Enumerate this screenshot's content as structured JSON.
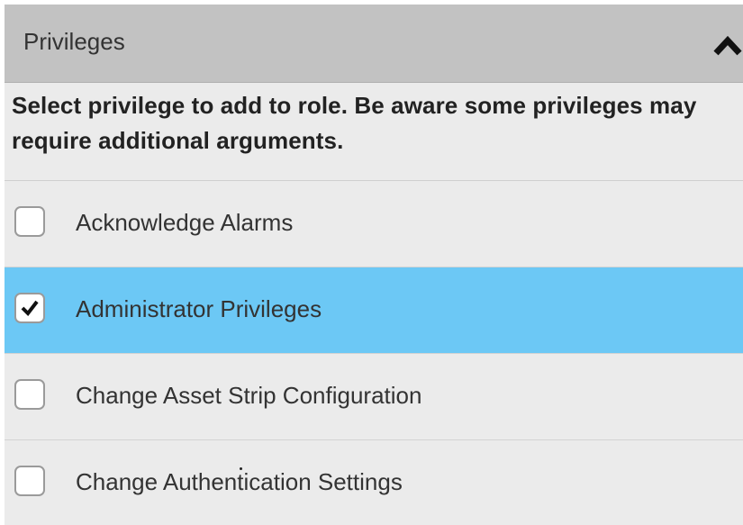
{
  "panel": {
    "title": "Privileges",
    "collapse_icon": "chevron-up-icon",
    "instructions": "Select privilege to add to role. Be aware some privileges may require additional arguments."
  },
  "privileges": [
    {
      "label": "Acknowledge Alarms",
      "checked": false
    },
    {
      "label": "Administrator Privileges",
      "checked": true
    },
    {
      "label": "Change Asset Strip Configuration",
      "checked": false
    },
    {
      "label": "Change Authentication Settings",
      "checked": false
    }
  ],
  "colors": {
    "header_bg": "#c2c2c2",
    "list_bg": "#ebebeb",
    "selected_bg": "#6cc8f5"
  }
}
